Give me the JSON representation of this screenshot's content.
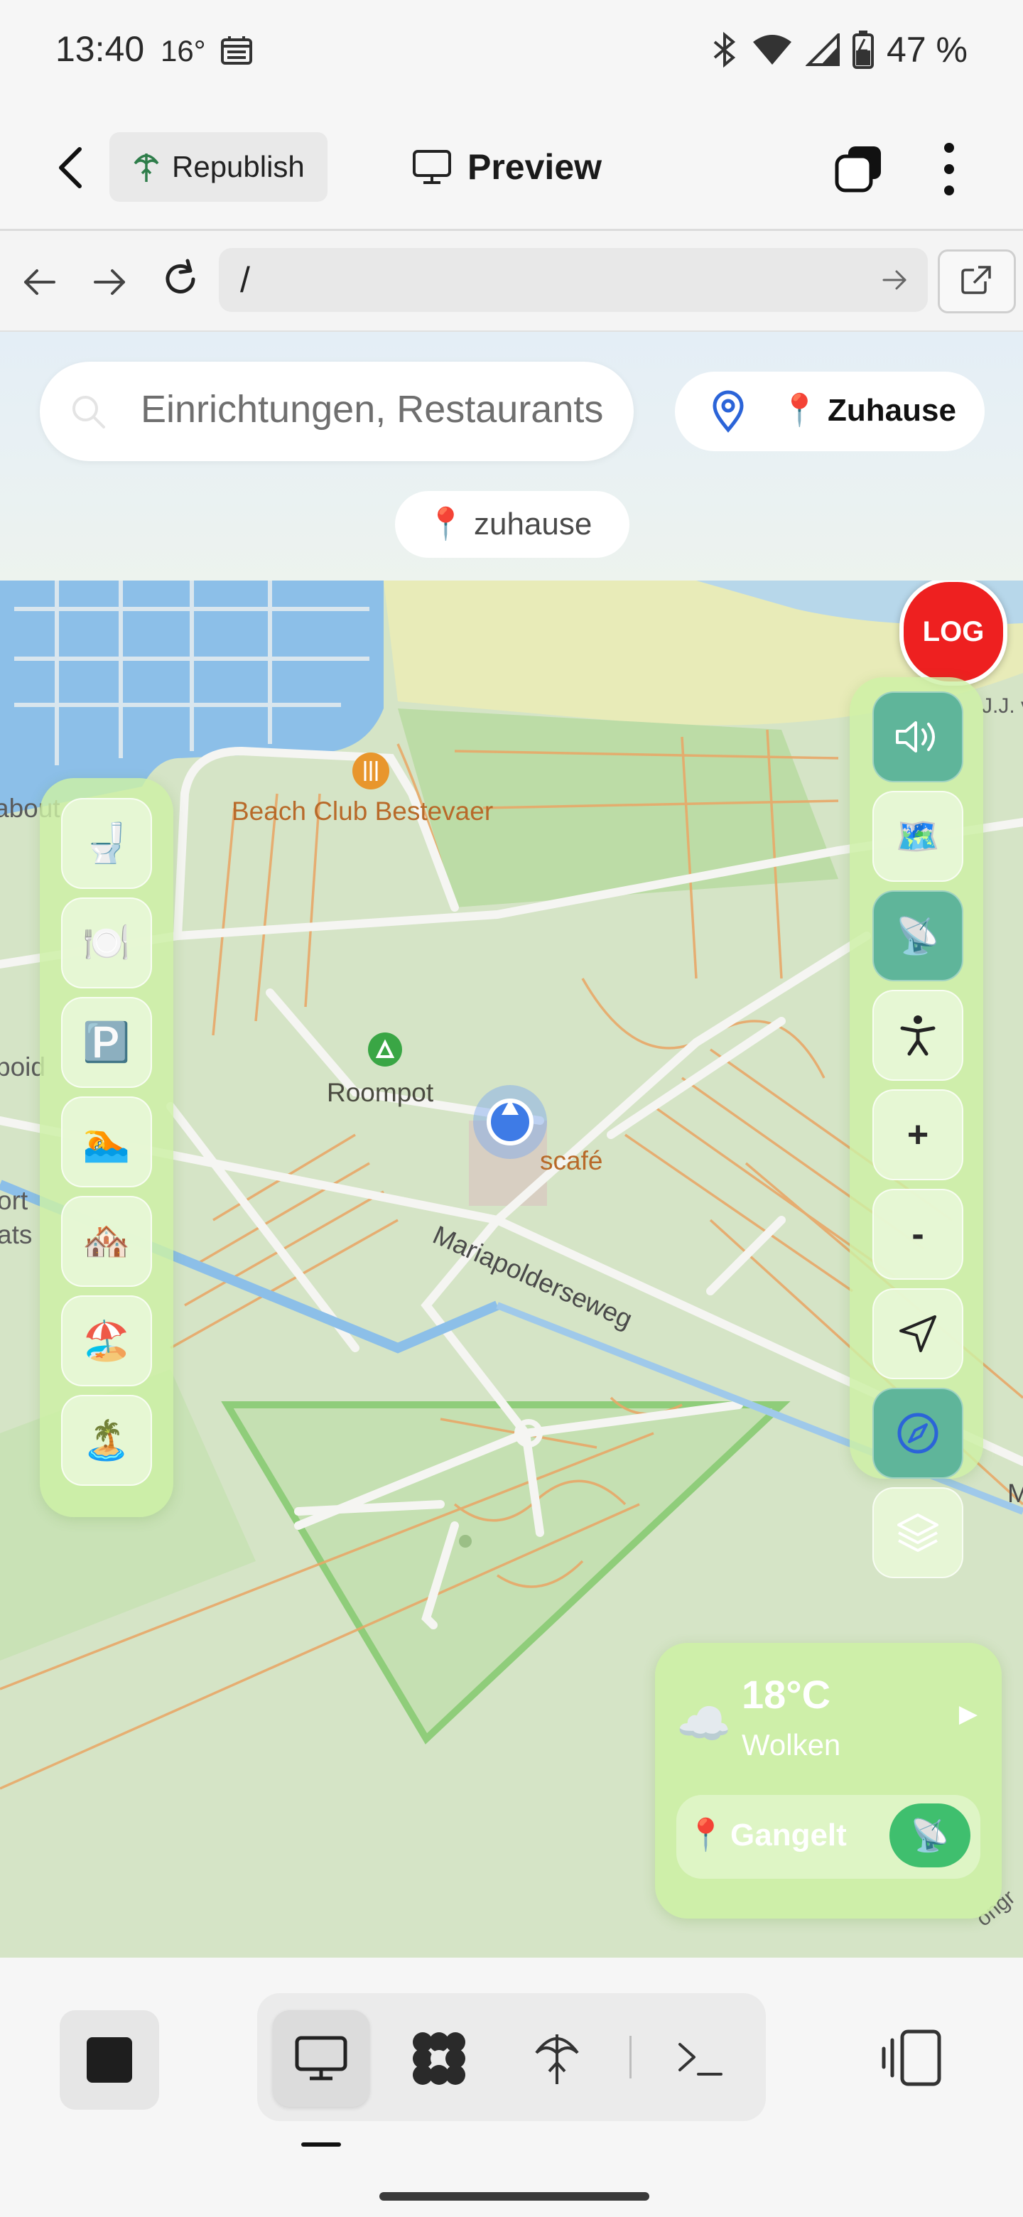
{
  "status_bar": {
    "time": "13:40",
    "temperature": "16°",
    "battery": "47 %"
  },
  "app_toolbar": {
    "republish_label": "Republish",
    "preview_label": "Preview"
  },
  "browser_bar": {
    "url": "/"
  },
  "header": {
    "search_placeholder": "Einrichtungen, Restaurants",
    "home_button_label": "📍 Zuhause",
    "home_chip_label": "📍 zuhause"
  },
  "map": {
    "labels": {
      "beach_club": "Beach Club Bestevaer",
      "roompot": "Roompot",
      "cafe": "scafé",
      "street": "Mariapolderseweg",
      "edge_1": "about",
      "edge_2": "boid",
      "edge_3": "ort",
      "edge_4": "ats",
      "edge_5": "J.J. v",
      "edge_6": "M",
      "edge_7": "ongr"
    },
    "log_label": "LOG",
    "category_buttons": [
      {
        "icon": "🚽",
        "name": "toilet"
      },
      {
        "icon": "🍽️",
        "name": "restaurant"
      },
      {
        "icon": "🅿️",
        "name": "parking"
      },
      {
        "icon": "🏊",
        "name": "swimming"
      },
      {
        "icon": "🏘️",
        "name": "accommodation"
      },
      {
        "icon": "🏖️",
        "name": "beach"
      },
      {
        "icon": "🏝️",
        "name": "island"
      }
    ],
    "controls": {
      "sound_icon": "speaker-icon",
      "map_icon": "🗺️",
      "satellite_icon": "📡",
      "accessibility_icon": "accessibility-icon",
      "zoom_in": "+",
      "zoom_out": "-",
      "navigate_icon": "navigation-arrow-icon",
      "compass_icon": "compass-icon",
      "layers_icon": "layers-icon"
    },
    "colors": {
      "panel": "#cdf0a5",
      "active_button": "#5fb59a",
      "log_button": "#ee2020",
      "water": "#8bbde6",
      "road_orange": "#e8a060",
      "green_area": "#b9d9a3"
    }
  },
  "weather": {
    "icon": "☁️",
    "temperature": "18°C",
    "description": "Wolken",
    "location_pin": "📍",
    "location": "Gangelt",
    "satellite": "📡",
    "arrow": "▶"
  },
  "bottom_bar": {
    "tabs": [
      "preview-icon",
      "workflows-icon",
      "deploy-icon",
      "console-icon"
    ]
  }
}
